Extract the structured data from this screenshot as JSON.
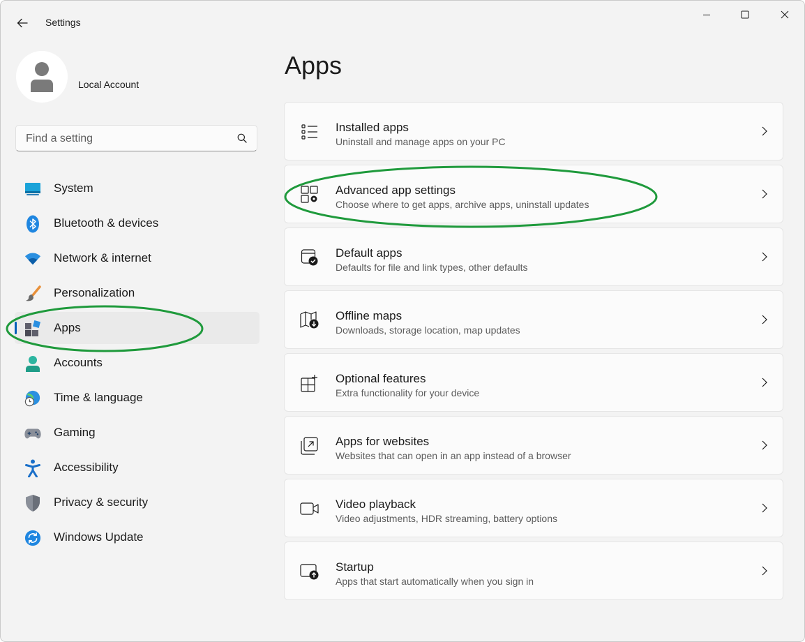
{
  "titlebar": {
    "app_title": "Settings"
  },
  "account": {
    "name": "Local Account"
  },
  "search": {
    "placeholder": "Find a setting"
  },
  "sidebar": {
    "items": [
      {
        "label": "System",
        "icon": "monitor-icon"
      },
      {
        "label": "Bluetooth & devices",
        "icon": "bluetooth-icon"
      },
      {
        "label": "Network & internet",
        "icon": "wifi-icon"
      },
      {
        "label": "Personalization",
        "icon": "paintbrush-icon"
      },
      {
        "label": "Apps",
        "icon": "apps-icon",
        "selected": true
      },
      {
        "label": "Accounts",
        "icon": "person-icon"
      },
      {
        "label": "Time & language",
        "icon": "globe-clock-icon"
      },
      {
        "label": "Gaming",
        "icon": "gamepad-icon"
      },
      {
        "label": "Accessibility",
        "icon": "accessibility-icon"
      },
      {
        "label": "Privacy & security",
        "icon": "shield-icon"
      },
      {
        "label": "Windows Update",
        "icon": "sync-icon"
      }
    ]
  },
  "main": {
    "title": "Apps",
    "cards": [
      {
        "title": "Installed apps",
        "desc": "Uninstall and manage apps on your PC",
        "icon": "list-icon"
      },
      {
        "title": "Advanced app settings",
        "desc": "Choose where to get apps, archive apps, uninstall updates",
        "icon": "app-gear-icon"
      },
      {
        "title": "Default apps",
        "desc": "Defaults for file and link types, other defaults",
        "icon": "default-app-icon"
      },
      {
        "title": "Offline maps",
        "desc": "Downloads, storage location, map updates",
        "icon": "map-download-icon"
      },
      {
        "title": "Optional features",
        "desc": "Extra functionality for your device",
        "icon": "grid-add-icon"
      },
      {
        "title": "Apps for websites",
        "desc": "Websites that can open in an app instead of a browser",
        "icon": "open-in-app-icon"
      },
      {
        "title": "Video playback",
        "desc": "Video adjustments, HDR streaming, battery options",
        "icon": "video-icon"
      },
      {
        "title": "Startup",
        "desc": "Apps that start automatically when you sign in",
        "icon": "startup-icon"
      }
    ]
  },
  "colors": {
    "accent": "#005fb8",
    "annotation": "#1f9a3c",
    "window_bg": "#f3f3f3",
    "card_bg": "#fbfbfb"
  }
}
